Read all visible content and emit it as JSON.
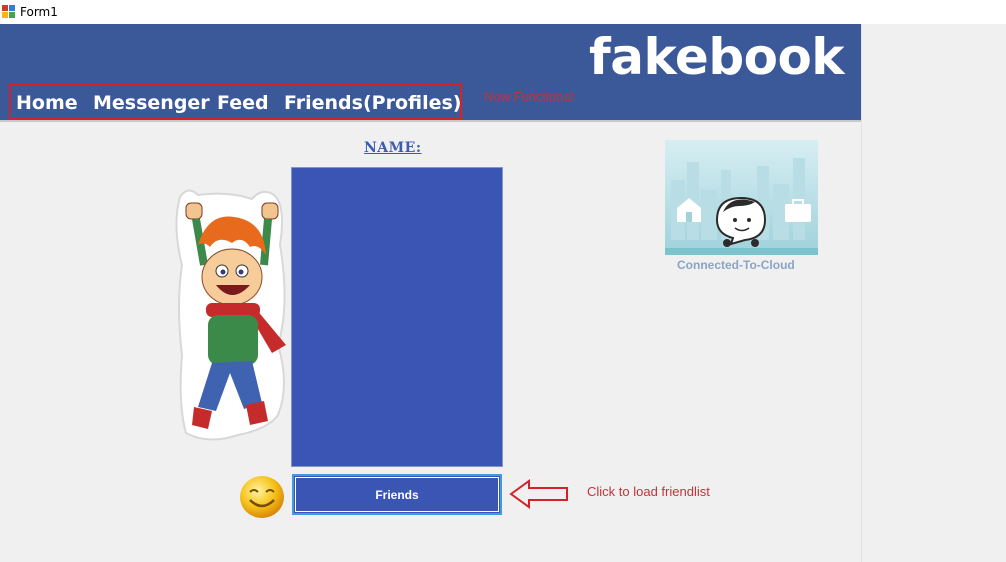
{
  "window": {
    "title": "Form1"
  },
  "header": {
    "brand": "fakebook",
    "nav": {
      "home": "Home",
      "messenger": "Messenger",
      "feed": "Feed",
      "friends": "Friends(Profiles)"
    },
    "nav_note": "Now Functional"
  },
  "profile": {
    "name_label": "NAME:",
    "friends_button": "Friends",
    "friends_hint": "Click to load friendlist"
  },
  "cloud": {
    "status_label": "Connected-To-Cloud"
  },
  "colors": {
    "brand_blue": "#3b5998",
    "list_blue": "#3a55b4",
    "annotation_red": "#d5212b"
  }
}
